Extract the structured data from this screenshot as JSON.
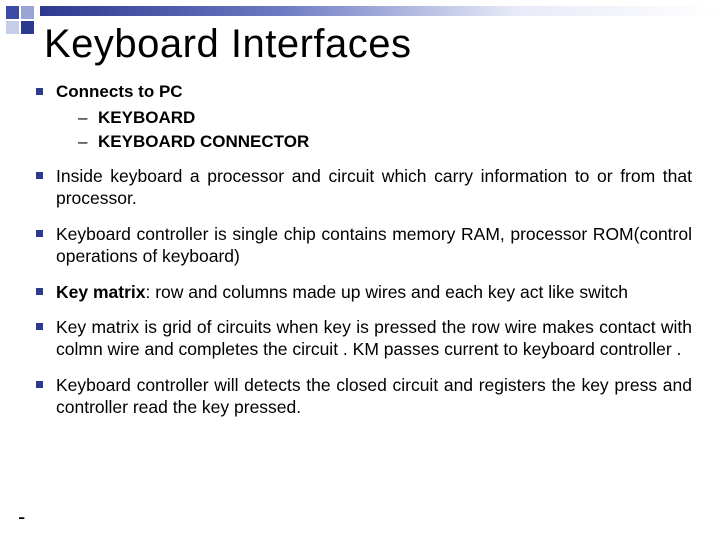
{
  "title": "Keyboard Interfaces",
  "bullets": {
    "b1": "Connects to PC",
    "sub": [
      "KEYBOARD",
      "KEYBOARD CONNECTOR"
    ],
    "p": [
      "Inside keyboard a processor and circuit which carry information to or from  that processor.",
      "Keyboard controller is single chip contains memory RAM, processor ROM(control operations of keyboard)",
      ": row and columns made up wires and each key act like switch",
      "Key matrix is grid of circuits when key is pressed the row wire makes contact with colmn wire and completes the circuit . KM passes current to keyboard controller .",
      "Keyboard controller will detects the closed circuit and registers the key press and controller read the key pressed."
    ],
    "p3_bold": "Key matrix"
  },
  "footer": "-"
}
